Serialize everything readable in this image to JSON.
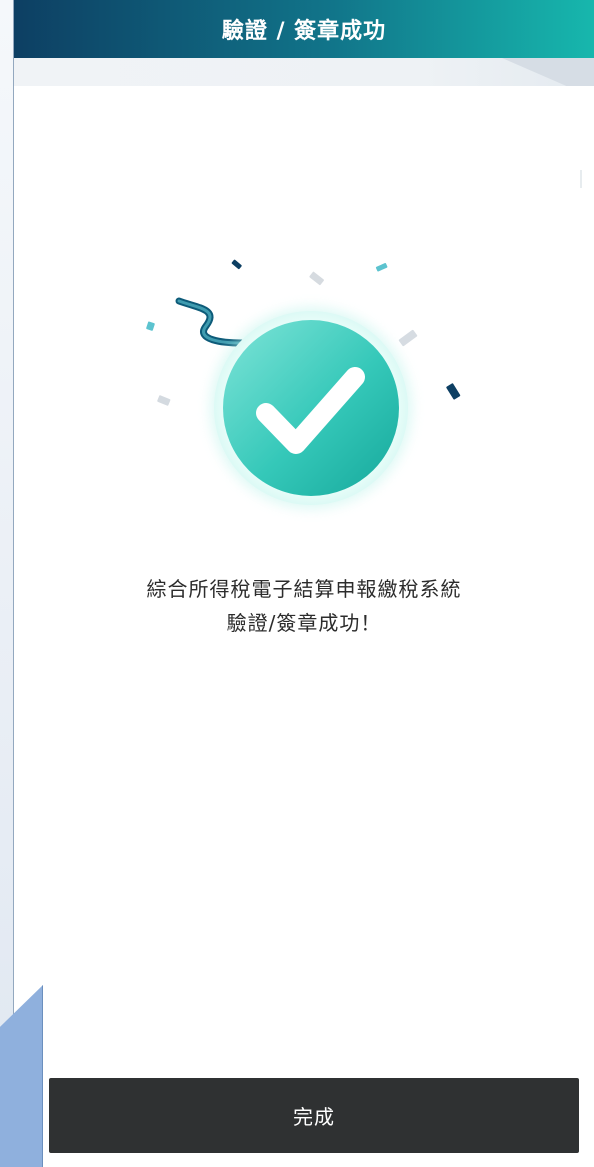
{
  "header": {
    "title": "驗證 / 簽章成功"
  },
  "main": {
    "message_line_1": "綜合所得稅電子結算申報繳稅系統",
    "message_line_2": "驗證/簽章成功！"
  },
  "actions": {
    "done_label": "完成"
  },
  "icons": {
    "success": "check-circle-icon",
    "confetti": "confetti-icon"
  },
  "colors": {
    "header_start": "#0d3f63",
    "header_end": "#17b7ad",
    "success_teal": "#5ed6c8",
    "button_dark": "#2f3132"
  }
}
